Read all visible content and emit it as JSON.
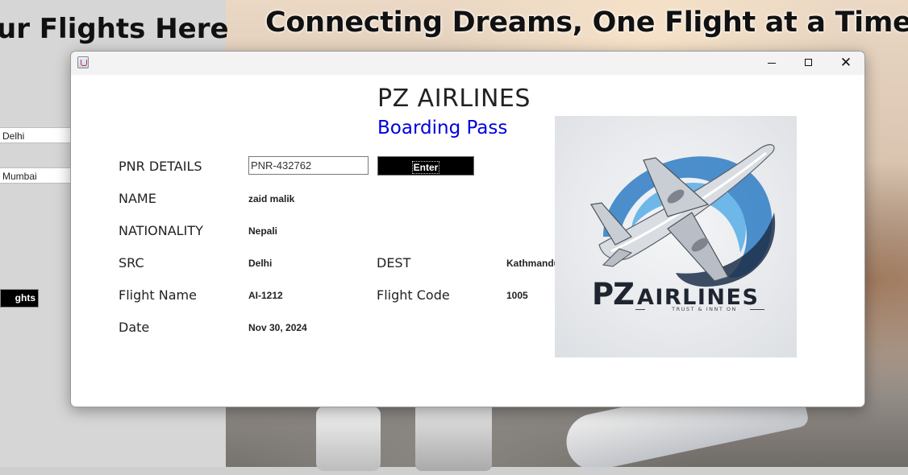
{
  "background_app": {
    "heading_left": "ur Flights Here",
    "heading_right": "Connecting Dreams, One Flight at a Time",
    "source_field_value": "Delhi",
    "dest_field_value": "Mumbai",
    "button_label": "ghts"
  },
  "window": {
    "title": "PZ AIRLINES",
    "subtitle": "Boarding Pass",
    "controls": {
      "minimize": "minimize",
      "maximize": "maximize",
      "close": "✕"
    },
    "colors": {
      "subtitle": "#0000dd",
      "button_bg": "#000000"
    }
  },
  "form": {
    "pnr_label": "PNR DETAILS",
    "pnr_value": "PNR-432762",
    "enter_label": "Enter",
    "name_label": "NAME",
    "name_value": "zaid malik",
    "nationality_label": "NATIONALITY",
    "nationality_value": "Nepali",
    "src_label": "SRC",
    "src_value": "Delhi",
    "dest_label": "DEST",
    "dest_value": "Kathmandu",
    "flight_name_label": "Flight Name",
    "flight_name_value": "AI-1212",
    "flight_code_label": "Flight Code",
    "flight_code_value": "1005",
    "date_label": "Date",
    "date_value": "Nov 30, 2024"
  },
  "logo": {
    "brand_main": "PZ",
    "brand_rest": "AIRLINES",
    "tagline": "TRUST & INNT ON",
    "icon": "airplane-swoosh-logo"
  }
}
